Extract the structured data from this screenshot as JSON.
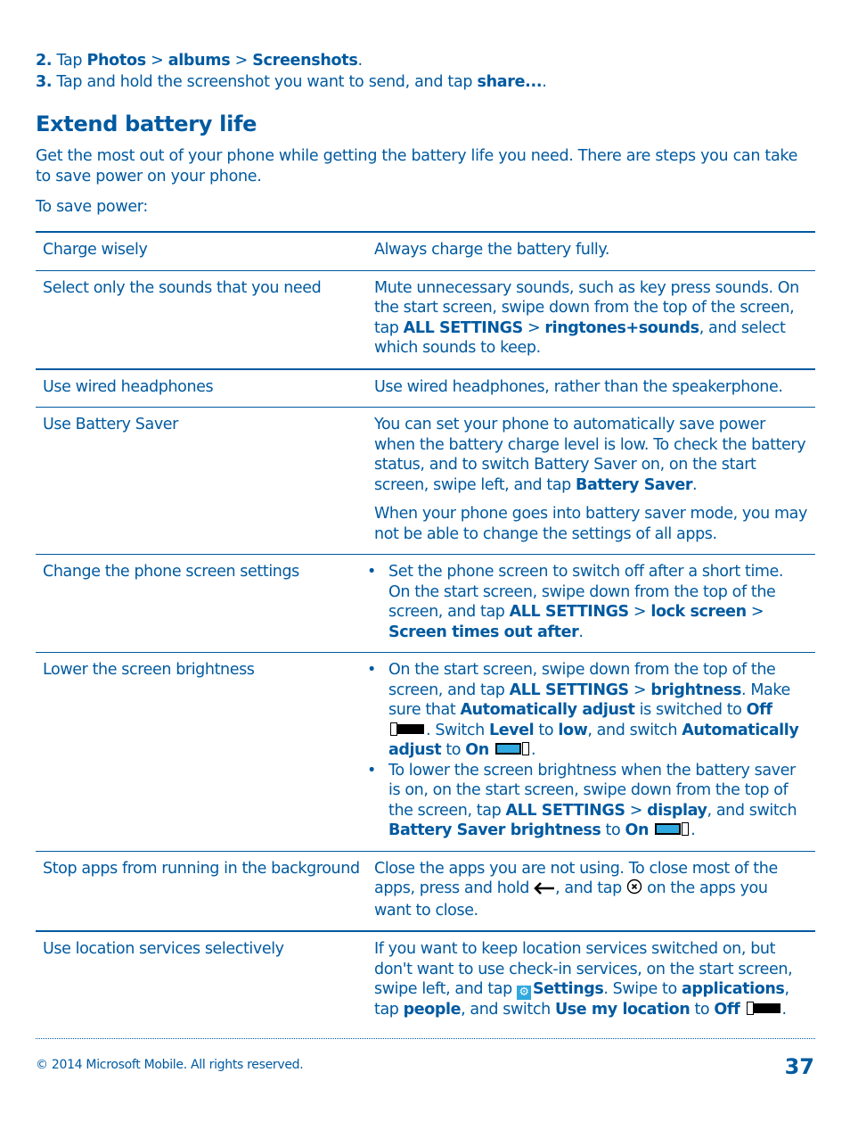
{
  "steps": [
    {
      "num": "2.",
      "parts": {
        "t1": " Tap ",
        "b1": "Photos",
        "t2": " > ",
        "b2": "albums",
        "t3": " > ",
        "b3": "Screenshots",
        "t4": "."
      }
    },
    {
      "num": "3.",
      "parts": {
        "t1": " Tap and hold the screenshot you want to send, and tap ",
        "b1": "share...",
        "t2": "."
      }
    }
  ],
  "section": {
    "title": "Extend battery life",
    "intro": "Get the most out of your phone while getting the battery life you need. There are steps you can take to save power on your phone.",
    "to_save": "To save power:"
  },
  "rows": [
    {
      "label": "Charge wisely",
      "desc": "Always charge the battery fully."
    },
    {
      "label": "Select only the sounds that you need",
      "desc": {
        "t1": "Mute unnecessary sounds, such as key press sounds. On the start screen, swipe down from the top of the screen, tap ",
        "b1": "ALL SETTINGS",
        "t2": " > ",
        "b2": "ringtones+sounds",
        "t3": ", and select which sounds to keep."
      }
    },
    {
      "label": "Use wired headphones",
      "desc": "Use wired headphones, rather than the speakerphone."
    },
    {
      "label": "Use Battery Saver",
      "desc": {
        "t1": "You can set your phone to automatically save power when the battery charge level is low. To check the battery status, and to switch Battery Saver on, on the start screen, swipe left, and tap ",
        "b1": "Battery Saver",
        "t2": ".",
        "p2": "When your phone goes into battery saver mode, you may not be able to change the settings of all apps."
      }
    },
    {
      "label": "Change the phone screen settings",
      "bullets": [
        {
          "t1": "Set the phone screen to switch off after a short time. On the start screen, swipe down from the top of the screen, and tap ",
          "b1": "ALL SETTINGS",
          "t2": " > ",
          "b2": "lock screen",
          "t3": " > ",
          "b3": "Screen times out after",
          "t4": "."
        }
      ]
    },
    {
      "label": "Lower the screen brightness",
      "bullets": [
        {
          "t1": "On the start screen, swipe down from the top of the screen, and tap ",
          "b1": "ALL SETTINGS",
          "t2": " > ",
          "b2": "brightness",
          "t3": ". Make sure that ",
          "b3": "Automatically adjust",
          "t4": " is switched to ",
          "b4": "Off",
          "t5": ". Switch ",
          "b5": "Level",
          "t6": " to ",
          "b6": "low",
          "t7": ", and switch ",
          "b7": "Automatically adjust",
          "t8": " to ",
          "b8": "On",
          "t9": "."
        },
        {
          "t1": "To lower the screen brightness when the battery saver is on, on the start screen, swipe down from the top of the screen, tap ",
          "b1": "ALL SETTINGS",
          "t2": " > ",
          "b2": "display",
          "t3": ", and switch ",
          "b3": "Battery Saver brightness",
          "t4": " to ",
          "b4": "On",
          "t5": "."
        }
      ]
    },
    {
      "label": "Stop apps from running in the background",
      "desc": {
        "t1": "Close the apps you are not using. To close most of the apps, press and hold ",
        "t2": ", and tap ",
        "t3": " on the apps you want to close."
      }
    },
    {
      "label": "Use location services selectively",
      "desc": {
        "t1": "If you want to keep location services switched on, but don't want to use check-in services, on the start screen, swipe left, and tap ",
        "b1": "Settings",
        "t2": ". Swipe to ",
        "b2": "applications",
        "t3": ", tap ",
        "b3": "people",
        "t4": ", and switch ",
        "b4": "Use my location",
        "t5": " to ",
        "b5": "Off",
        "t6": "."
      }
    }
  ],
  "icons": {
    "bullet": "•",
    "back_arrow": "🡐",
    "close_circle": "⊗",
    "gear": "⚙"
  },
  "colors": {
    "text": "#005aa0",
    "toggle_on": "#2fa9df"
  },
  "footer": {
    "copyright": "© 2014 Microsoft Mobile. All rights reserved.",
    "page_number": "37"
  }
}
